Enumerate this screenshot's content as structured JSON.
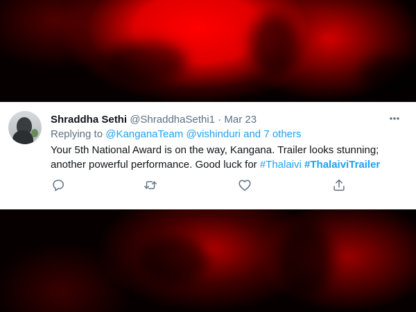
{
  "tweet": {
    "display_name": "Shraddha Sethi",
    "handle": "@ShraddhaSethi1",
    "separator": "·",
    "date": "Mar 23",
    "reply_prefix": "Replying to",
    "reply_mention_1": "@KanganaTeam",
    "reply_mention_2": "@vishinduri",
    "reply_others": "and 7 others",
    "text": "Your 5th National Award is on the way, Kangana. Trailer looks stunning; another powerful performance. Good luck for",
    "hashtag_1": "#Thalaivi",
    "hashtag_2": "#ThalaiviTrailer"
  },
  "actions": {
    "reply_icon": "comment-icon",
    "retweet_icon": "retweet-icon",
    "like_icon": "heart-icon",
    "share_icon": "share-icon",
    "more_icon": "ellipsis-icon"
  },
  "colors": {
    "accent": "#1da1f2",
    "secondary_text": "#5b7083",
    "primary_text": "#0f1419",
    "background_red": "#ff0000"
  }
}
